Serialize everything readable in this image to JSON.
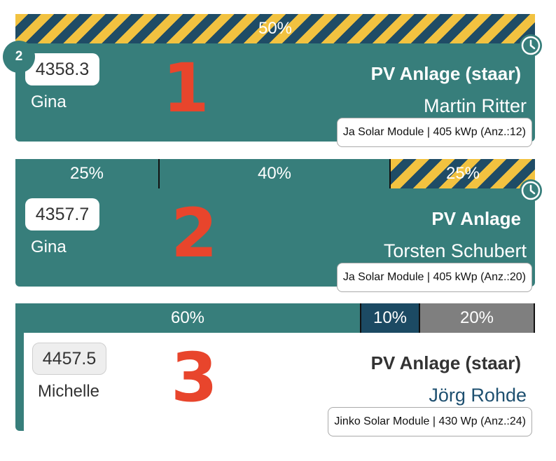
{
  "cards": [
    {
      "segments": [
        {
          "label": "50%"
        }
      ],
      "badge": "2",
      "id_value": "4358.3",
      "person": "Gina",
      "number": "1",
      "project": "PV Anlage (staar)",
      "customer": "Martin Ritter",
      "module": "Ja Solar Module | 405 kWp (Anz.:12)",
      "icons": [
        "clock-icon"
      ]
    },
    {
      "segments": [
        {
          "label": "25%"
        },
        {
          "label": "40%"
        },
        {
          "label": "25%"
        }
      ],
      "id_value": "4357.7",
      "person": "Gina",
      "number": "2",
      "project": "PV Anlage",
      "customer": "Torsten Schubert",
      "module": "Ja Solar Module | 405 kWp (Anz.:20)",
      "icons": [
        "clock-icon"
      ]
    },
    {
      "segments": [
        {
          "label": "60%"
        },
        {
          "label": "10%"
        },
        {
          "label": "20%"
        }
      ],
      "id_value": "4457.5",
      "person": "Michelle",
      "number": "3",
      "project": "PV Anlage (staar)",
      "customer": "Jörg Rohde",
      "module": "Jinko Solar Module | 430 Wp (Anz.:24)"
    }
  ],
  "colors": {
    "teal": "#377e7b",
    "navy": "#1c4a63",
    "gray": "#7f7f7f",
    "stripe_yellow": "#f2c240",
    "number_red": "#e8452c"
  }
}
